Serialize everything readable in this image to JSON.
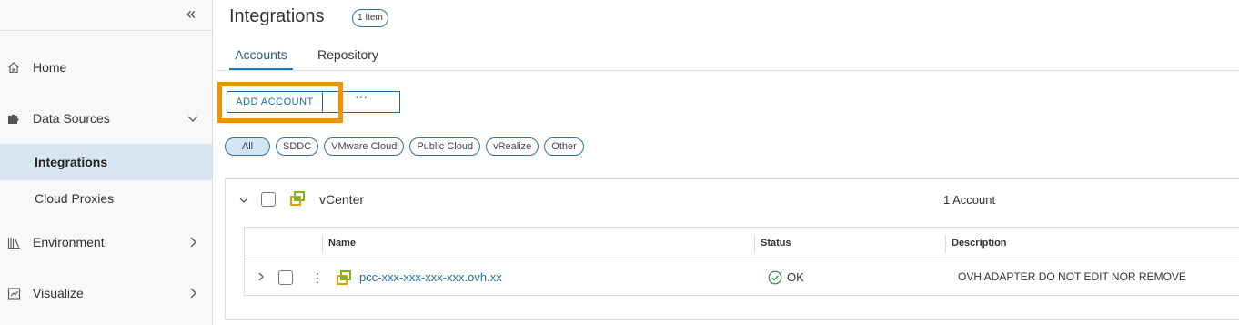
{
  "sidebar": {
    "collapse_glyph": "«",
    "items": [
      {
        "label": "Home",
        "icon": "home-icon"
      },
      {
        "label": "Data Sources",
        "icon": "puzzle-icon",
        "expanded": true,
        "children": [
          {
            "label": "Integrations",
            "active": true
          },
          {
            "label": "Cloud Proxies"
          }
        ]
      },
      {
        "label": "Environment",
        "icon": "library-icon"
      },
      {
        "label": "Visualize",
        "icon": "chart-icon"
      }
    ]
  },
  "header": {
    "title": "Integrations",
    "count_badge": "1 Item"
  },
  "tabs": [
    {
      "label": "Accounts",
      "active": true
    },
    {
      "label": "Repository"
    }
  ],
  "toolbar": {
    "add_label": "ADD ACCOUNT",
    "more_label": "···"
  },
  "filters": [
    {
      "label": "All",
      "active": true
    },
    {
      "label": "SDDC"
    },
    {
      "label": "VMware Cloud"
    },
    {
      "label": "Public Cloud"
    },
    {
      "label": "vRealize"
    },
    {
      "label": "Other"
    }
  ],
  "group": {
    "title": "vCenter",
    "count": "1 Account",
    "columns": [
      "Name",
      "Status",
      "Description"
    ],
    "rows": [
      {
        "name": "pcc-xxx-xxx-xxx-xxx.ovh.xx",
        "status": "OK",
        "description": "OVH ADAPTER DO NOT EDIT NOR REMOVE"
      }
    ]
  },
  "colors": {
    "accent": "#1b6ea5",
    "highlight": "#f39200",
    "active_nav": "#d8e6f1",
    "ok_green": "#2f8a3e"
  }
}
